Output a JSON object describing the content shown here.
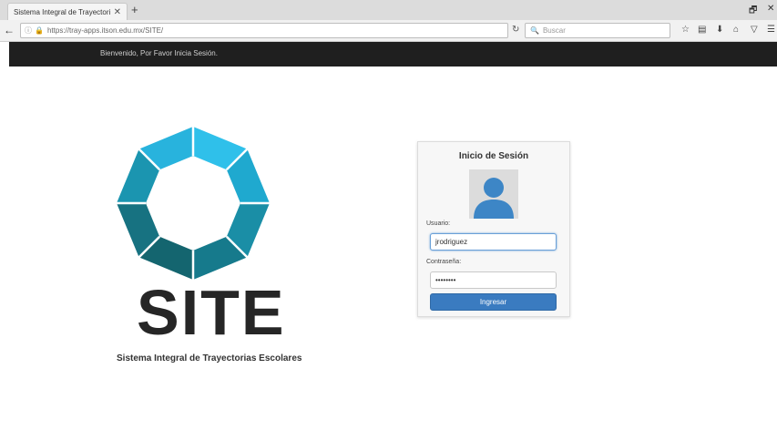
{
  "browser": {
    "tab_title": "Sistema Integral de Trayectorias",
    "tab_close": "✕",
    "new_tab": "+",
    "url": "https://tray-apps.itson.edu.mx/SITE/",
    "search_placeholder": "Buscar",
    "window_restore": "🗗",
    "window_close": "✕"
  },
  "header": {
    "welcome_text": "Bienvenido, Por Favor Inicia Sesión."
  },
  "branding": {
    "logo_text": "SITE",
    "subtitle": "Sistema Integral de Trayectorias Escolares",
    "colors": [
      "#2fc0ea",
      "#1f9fc0",
      "#1a7f96",
      "#14616f"
    ]
  },
  "login": {
    "title": "Inicio de Sesión",
    "username_label": "Usuario:",
    "username_value": "jrodriguez",
    "password_label": "Contraseña:",
    "password_value": "••••••••",
    "submit_label": "Ingresar",
    "accent_color": "#3a7bc0"
  }
}
